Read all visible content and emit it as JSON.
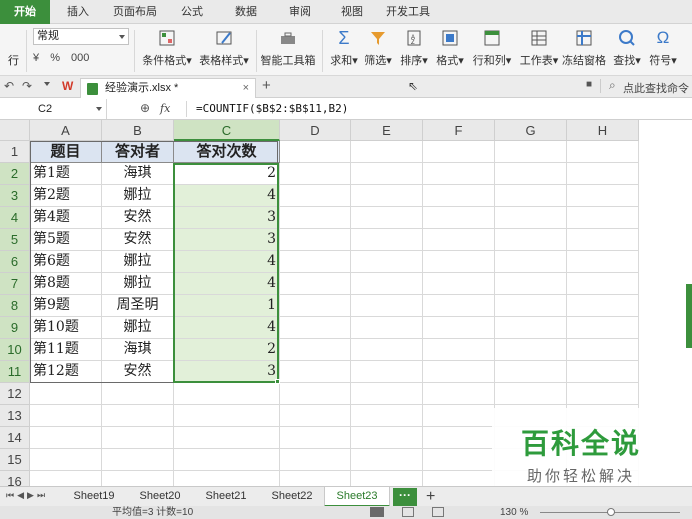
{
  "menu_tabs": [
    "开始",
    "插入",
    "页面布局",
    "公式",
    "数据",
    "审阅",
    "视图",
    "开发工具"
  ],
  "ribbon": {
    "number_format": "常规",
    "row_label": "行",
    "small_buttons": [
      "%",
      "000"
    ],
    "items": [
      "条件格式",
      "表格样式",
      "智能工具箱",
      "求和",
      "筛选",
      "排序",
      "格式",
      "行和列",
      "工作表",
      "冻结窗格",
      "查找",
      "符号"
    ]
  },
  "doc_tab": {
    "name": "经验演示.xlsx *"
  },
  "search_command": "点此查找命令",
  "formula_bar": {
    "cell_ref": "C2",
    "fx": "fx",
    "formula": "=COUNTIF($B$2:$B$11,B2)"
  },
  "columns": [
    "A",
    "B",
    "C",
    "D",
    "E",
    "F",
    "G",
    "H"
  ],
  "rows": [
    "1",
    "2",
    "3",
    "4",
    "5",
    "6",
    "7",
    "8",
    "9",
    "10",
    "11",
    "12",
    "13",
    "14",
    "15",
    "16"
  ],
  "table": {
    "headers": [
      "题目",
      "答对者",
      "答对次数"
    ],
    "data": [
      [
        "第1题",
        "海琪",
        "2"
      ],
      [
        "第2题",
        "娜拉",
        "4"
      ],
      [
        "第4题",
        "安然",
        "3"
      ],
      [
        "第5题",
        "安然",
        "3"
      ],
      [
        "第6题",
        "娜拉",
        "4"
      ],
      [
        "第8题",
        "娜拉",
        "4"
      ],
      [
        "第9题",
        "周圣明",
        "1"
      ],
      [
        "第10题",
        "娜拉",
        "4"
      ],
      [
        "第11题",
        "海琪",
        "2"
      ],
      [
        "第12题",
        "安然",
        "3"
      ]
    ]
  },
  "sheets": [
    "Sheet19",
    "Sheet20",
    "Sheet21",
    "Sheet22",
    "Sheet23"
  ],
  "active_sheet": "Sheet23",
  "more_sheets": "···",
  "add_sheet": "+",
  "status": {
    "stats": "平均值=3  计数=10",
    "zoom": "130 %"
  },
  "watermark": {
    "title": "百科全说",
    "subtitle": "助你轻松解决"
  },
  "colors": {
    "accent": "#3c8f3c",
    "header_fill": "#dbe4f1",
    "selection_fill": "#e2f0d9"
  }
}
